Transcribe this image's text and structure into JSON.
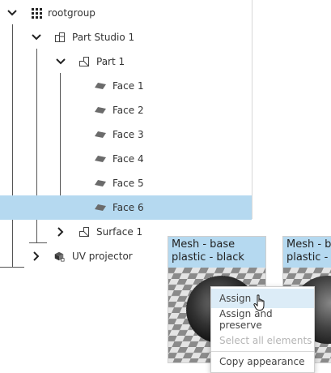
{
  "tree": {
    "rows": [
      {
        "label": "rootgroup",
        "icon": "grid-icon",
        "expanded": true,
        "selected": false
      },
      {
        "label": "Part Studio 1",
        "icon": "part-studio-icon",
        "expanded": true,
        "selected": false
      },
      {
        "label": "Part 1",
        "icon": "part-icon",
        "expanded": true,
        "selected": false
      },
      {
        "label": "Face 1",
        "icon": "face-icon",
        "selected": false
      },
      {
        "label": "Face 2",
        "icon": "face-icon",
        "selected": false
      },
      {
        "label": "Face 3",
        "icon": "face-icon",
        "selected": false
      },
      {
        "label": "Face 4",
        "icon": "face-icon",
        "selected": false
      },
      {
        "label": "Face 5",
        "icon": "face-icon",
        "selected": false
      },
      {
        "label": "Face 6",
        "icon": "face-icon",
        "selected": true
      },
      {
        "label": "Surface 1",
        "icon": "surface-icon",
        "expanded": false,
        "selected": false
      },
      {
        "label": "UV projector",
        "icon": "uv-projector-icon",
        "expanded": false,
        "selected": false
      }
    ]
  },
  "materials": [
    {
      "title": "Mesh - base plastic - black"
    },
    {
      "title": "Mesh - base plastic - "
    }
  ],
  "context_menu": {
    "items": [
      {
        "label": "Assign",
        "state": "hover"
      },
      {
        "label": "Assign and preserve",
        "state": "normal"
      },
      {
        "label": "Select all elements",
        "state": "disabled"
      },
      {
        "label": "Copy appearance",
        "state": "normal"
      }
    ]
  },
  "colors": {
    "selection": "#b5d9f0",
    "menu_hover": "#dcecf7",
    "guide_line": "#555555"
  }
}
